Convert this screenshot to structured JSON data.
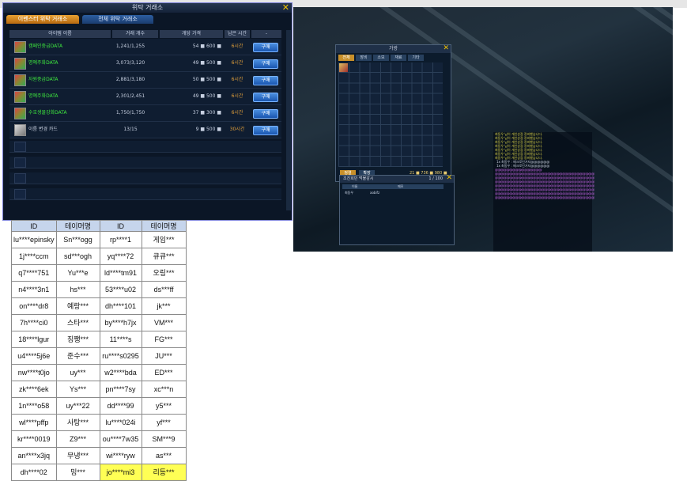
{
  "trade": {
    "title": "위탁 거래소",
    "tabs": [
      "이벤스터 위탁 거래소",
      "전체 위탁 거래소"
    ],
    "headers": [
      "아이템 이름",
      "거래 개수",
      "개당 가격",
      "남은 시간",
      "-"
    ],
    "rows": [
      {
        "name": "캠페인중급DATA",
        "qty": "1,241/1,255",
        "price": "54 ■ 600 ■",
        "time": "6시간",
        "btn": "구매"
      },
      {
        "name": "명예주화DATA",
        "qty": "3,073/3,120",
        "price": "49 ■ 500 ■",
        "time": "6시간",
        "btn": "구매"
      },
      {
        "name": "자원중급DATA",
        "qty": "2,881/3,180",
        "price": "50 ■ 500 ■",
        "time": "6시간",
        "btn": "구매"
      },
      {
        "name": "명예주화DATA",
        "qty": "2,301/2,451",
        "price": "49 ■ 500 ■",
        "time": "6시간",
        "btn": "구매"
      },
      {
        "name": "수호생물강화DATA",
        "qty": "1,750/1,750",
        "price": "37 ■ 300 ■",
        "time": "6시간",
        "btn": "구매"
      },
      {
        "name": "이름 변경 카드",
        "qty": "13/15",
        "price": "9 ■ 500 ■",
        "time": "30시간",
        "btn": "구매"
      }
    ]
  },
  "inventory": {
    "title": "가방",
    "tabs": [
      "전체",
      "장비",
      "소모",
      "재료",
      "기타"
    ],
    "buttons": [
      "정렬",
      "확장"
    ],
    "money": "21 ■ 736 ■ 980 ■"
  },
  "shop": {
    "title": "조진희민 먹물감시",
    "count": "1 / 100",
    "headers": [
      "이름",
      "메모"
    ],
    "row": [
      "최동우",
      "aobifz"
    ]
  },
  "chat": {
    "yellow_lines": [
      "최동우 님이 개인상점 정비했습니다.",
      "최동우 님이 개인상점 정비했습니다.",
      "최동우 님이 개인상점 정비했습니다.",
      "최동우 님이 개인상점 정비했습니다.",
      "최동우 님이 개인상점 정비했습니다.",
      "최동우 님이 개인상점 정비했습니다.",
      "최동우 님이 개인상점 정비했습니다."
    ],
    "white_lines": [
      "1x 최동우 : 메크로인거지@@@@@@",
      "1x 최동우 : 메크로인거지@@@@@@"
    ],
    "magenta_lines": [
      "@@@@@@@@@@@@@@@@",
      "@@@@@@@@@@@@@@@@@@@@@@@@@@@@@@@@@@",
      "@@@@@@@@@@@@@@@@@@@@@@@@@@@@@@@@@@",
      "@@@@@@@@@@@@@@@@@@@@@@@@@@@@@@@@@@",
      "@@@@@@@@@@@@@@@@@@@@@@@@@@@@@@@@@@",
      "@@@@@@@@@@@@@@@@@@@@@@@@@@@@@@@@@@",
      "@@@@@@@@@@@@@@@@@@@@@@@@@@@@@@@@@@",
      "@@@@@@@@@@@@@@@@@@@@@@@@@@@@@@@@@@"
    ]
  },
  "users": {
    "headers": [
      "ID",
      "테이머명",
      "ID",
      "테이머명"
    ],
    "rows": [
      [
        "lu****epinsky",
        "Sn***ogg",
        "rp****1",
        "게임***"
      ],
      [
        "1j****ccm",
        "sd***ogh",
        "yq****72",
        "큐큐***"
      ],
      [
        "q7****751",
        "Yu***e",
        "ld****tm91",
        "오링***"
      ],
      [
        "n4****3n1",
        "hs***",
        "53****u02",
        "ds***ff"
      ],
      [
        "on****dr8",
        "예랑***",
        "dh****101",
        "jk***"
      ],
      [
        "7h****ci0",
        "스타***",
        "by****h7jx",
        "VM***"
      ],
      [
        "18****lgur",
        "징쨍***",
        "11****s",
        "FG***"
      ],
      [
        "u4****5j6e",
        "준수***",
        "ru****s0295",
        "JU***"
      ],
      [
        "nw****t0jo",
        "uy***",
        "w2****bda",
        "ED***"
      ],
      [
        "zk****6ek",
        "Ys***",
        "pn****7sy",
        "xc***n"
      ],
      [
        "1n****o58",
        "uy***22",
        "dd****99",
        "y5***"
      ],
      [
        "wl****pffp",
        "사탕***",
        "lu****024i",
        "yf***"
      ],
      [
        "kr****0019",
        "Z9***",
        "ou****7w35",
        "SM***9"
      ],
      [
        "an****x3jq",
        "무냉***",
        "wi****ryw",
        "as***"
      ],
      [
        "dh****02",
        "밍***",
        "jo****mi3",
        "리등***"
      ]
    ],
    "highlight_color": "#ffff55"
  }
}
